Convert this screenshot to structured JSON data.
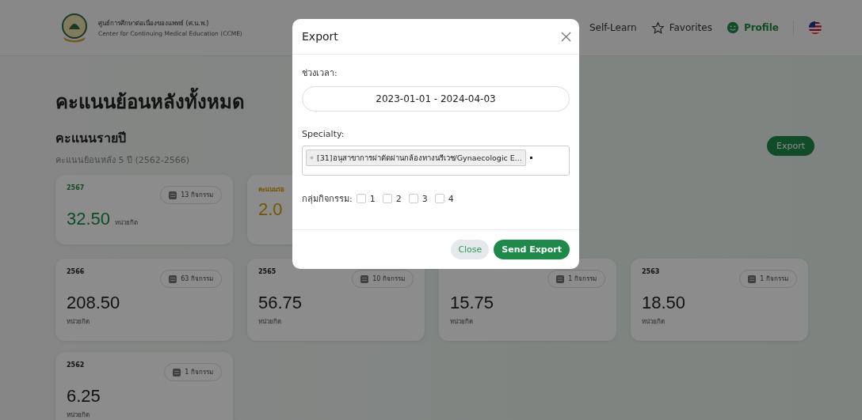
{
  "header": {
    "org_th": "ศูนย์การศึกษาต่อเนื่องของแพทย์ (ศ.น.พ.)",
    "org_en": "Center for Continuing Medical Education (CCME)",
    "nav": [
      {
        "label": "Self-Learn",
        "kind": "plain"
      },
      {
        "label": "Favorites",
        "kind": "star"
      },
      {
        "label": "Profile",
        "kind": "profile"
      }
    ]
  },
  "page_title": "คะแนนย้อนหลังทั้งหมด",
  "section_title": "คะแนนรายปี",
  "section_subtitle": "คะแนนย้อนหลัง 5 ปี (2562-2566)",
  "export_button": "Export",
  "cards": [
    {
      "kind": "current",
      "year": "2567",
      "activities": "13 กิจกรรม",
      "value": "32.50",
      "unit": "หน่วยกิต"
    },
    {
      "kind": "pending",
      "year": "คะแนนรอ",
      "value": "2.0"
    },
    {
      "kind": "year",
      "year": "2566",
      "activities": "63 กิจกรรม",
      "value": "208.50",
      "unit": "หน่วยกิต"
    },
    {
      "kind": "year",
      "year": "2565",
      "activities": "10 กิจกรรม",
      "value": "56.75",
      "unit": "หน่วยกิต"
    },
    {
      "kind": "year",
      "activities": "1 กิจกรรม",
      "value": "15.75",
      "unit": "หน่วยกิต"
    },
    {
      "kind": "year",
      "year": "2563",
      "activities": "1 กิจกรรม",
      "value": "18.50",
      "unit": "หน่วยกิต"
    },
    {
      "kind": "year",
      "year": "2562",
      "activities": "1 กิจกรรม",
      "value": "6.25",
      "unit": "หน่วยกิต"
    }
  ],
  "modal": {
    "title": "Export",
    "date_label": "ช่วงเวลา:",
    "date_value": "2023-01-01 - 2024-04-03",
    "specialty_label": "Specialty:",
    "specialty_tags": [
      {
        "label": "[31]อนุสาขาการผ่าตัดผ่านกล้องทางนรีเวช/Gynaecologic E..."
      }
    ],
    "group_label": "กลุ่มกิจกรรม:",
    "groups": [
      {
        "label": "1",
        "checked": false
      },
      {
        "label": "2",
        "checked": false
      },
      {
        "label": "3",
        "checked": false
      },
      {
        "label": "4",
        "checked": false
      }
    ],
    "close_button": "Close",
    "send_button": "Send Export"
  }
}
